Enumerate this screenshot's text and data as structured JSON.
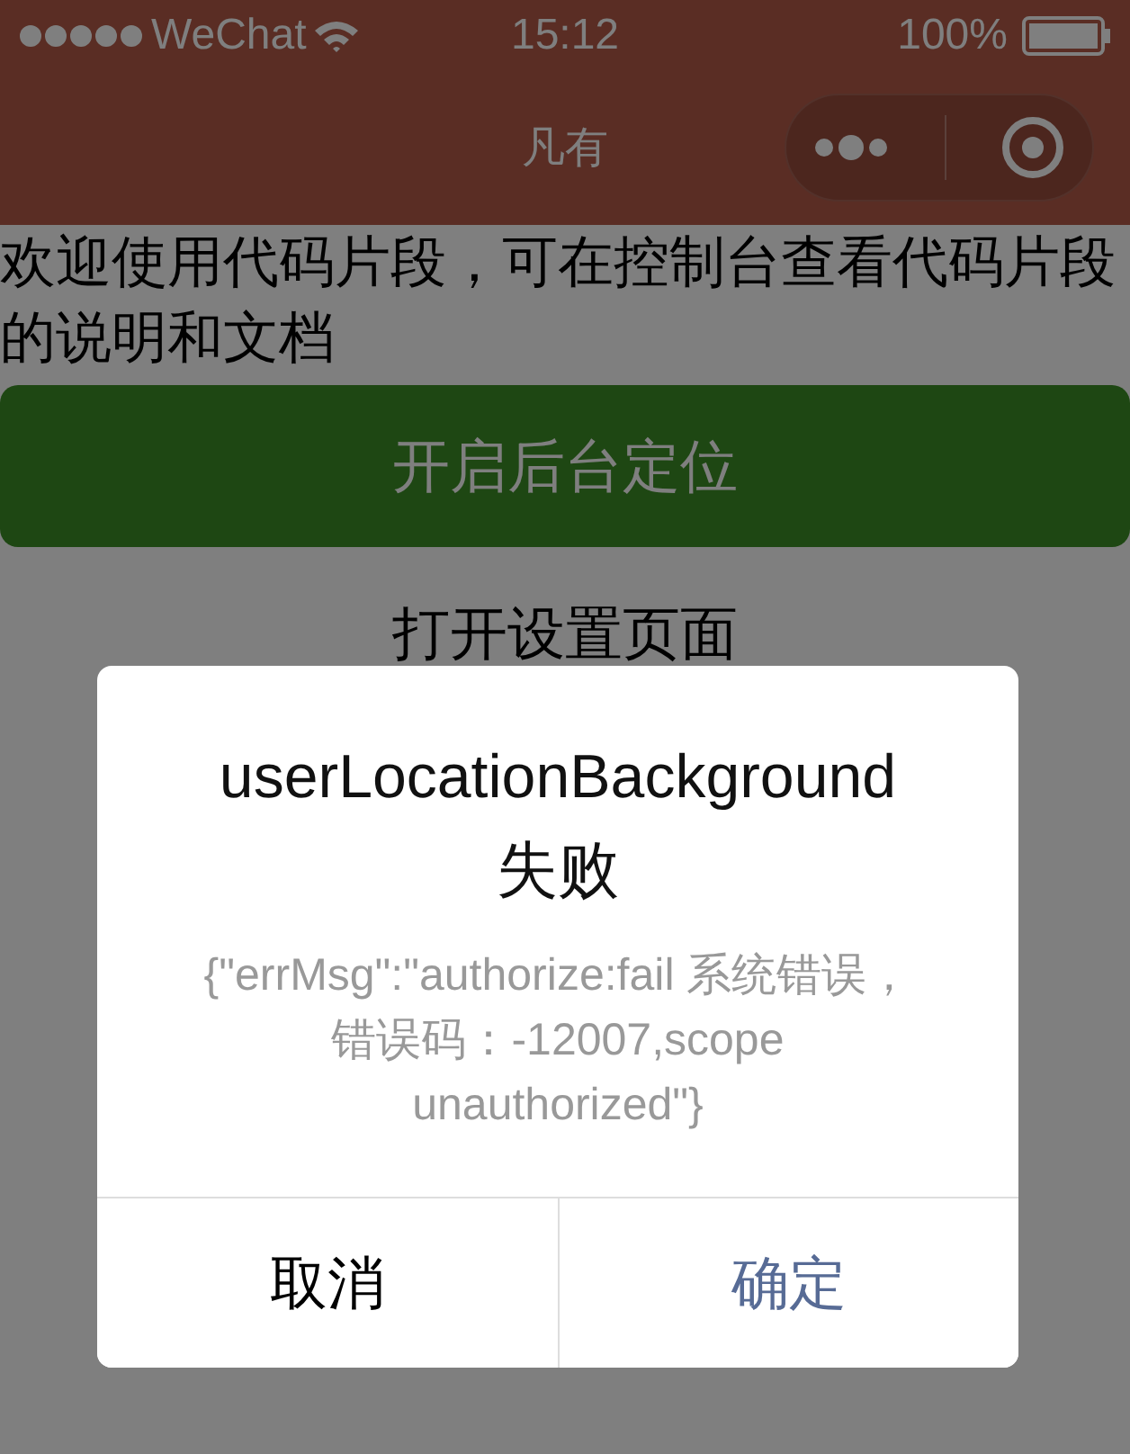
{
  "status_bar": {
    "carrier": "WeChat",
    "time": "15:12",
    "battery": "100%"
  },
  "nav_bar": {
    "title": "凡有"
  },
  "intro_text": "欢迎使用代码片段，可在控制台查看代码片段的说明和文档",
  "buttons": [
    {
      "label": "开启后台定位",
      "kind": "primary"
    },
    {
      "label": "打开设置页面",
      "kind": "plain"
    }
  ],
  "dialog": {
    "title": "userLocationBackground失败",
    "message": "{\"errMsg\":\"authorize:fail 系统错误，错误码：-12007,scope unauthorized\"}",
    "actions": [
      {
        "label": "取消",
        "kind": "cancel"
      },
      {
        "label": "确定",
        "kind": "confirm"
      }
    ]
  }
}
